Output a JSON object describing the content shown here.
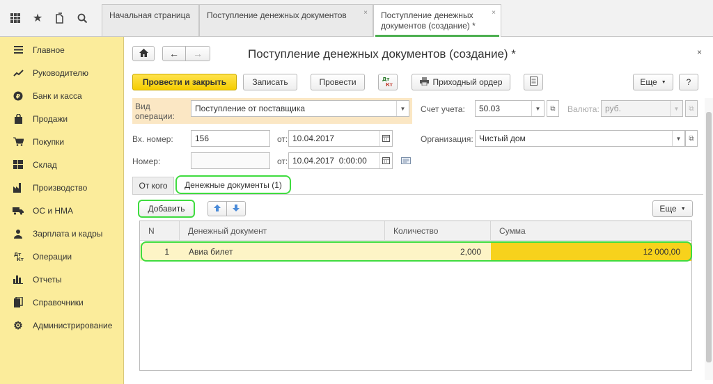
{
  "tabs": [
    {
      "label": "Начальная страница"
    },
    {
      "label": "Поступление денежных документов",
      "close": "×"
    },
    {
      "label": "Поступление денежных документов (создание) *",
      "close": "×"
    }
  ],
  "sidebar": {
    "items": [
      {
        "label": "Главное",
        "icon": "menu-icon"
      },
      {
        "label": "Руководителю",
        "icon": "trend-icon"
      },
      {
        "label": "Банк и касса",
        "icon": "ruble-icon"
      },
      {
        "label": "Продажи",
        "icon": "bag-icon"
      },
      {
        "label": "Покупки",
        "icon": "cart-icon"
      },
      {
        "label": "Склад",
        "icon": "grid-icon"
      },
      {
        "label": "Производство",
        "icon": "factory-icon"
      },
      {
        "label": "ОС и НМА",
        "icon": "truck-icon"
      },
      {
        "label": "Зарплата и кадры",
        "icon": "people-icon"
      },
      {
        "label": "Операции",
        "icon": "dt-kt-icon"
      },
      {
        "label": "Отчеты",
        "icon": "bar-chart-icon"
      },
      {
        "label": "Справочники",
        "icon": "book-icon"
      },
      {
        "label": "Администрирование",
        "icon": "gear-icon"
      }
    ]
  },
  "form": {
    "title": "Поступление денежных документов (создание) *",
    "close": "×",
    "toolbar": {
      "post_close": "Провести и закрыть",
      "save": "Записать",
      "post": "Провести",
      "dtkt": "Дт\nКт",
      "print": "Приходный ордер",
      "more": "Еще",
      "help": "?"
    },
    "operation_label": "Вид операции:",
    "operation_value": "Поступление от поставщика",
    "account_label": "Счет учета:",
    "account_value": "50.03",
    "currency_label": "Валюта:",
    "currency_value": "руб.",
    "in_number_label": "Вх. номер:",
    "in_number_value": "156",
    "from_label": "от:",
    "in_date": "10.04.2017",
    "org_label": "Организация:",
    "org_value": "Чистый дом",
    "number_label": "Номер:",
    "number_value": "",
    "doc_date": "10.04.2017  0:00:00"
  },
  "inner_tabs": {
    "from_whom": "От кого",
    "money_docs": "Денежные документы (1)"
  },
  "table_toolbar": {
    "add": "Добавить",
    "more": "Еще"
  },
  "table": {
    "columns": [
      "N",
      "Денежный документ",
      "Количество",
      "Сумма"
    ],
    "rows": [
      {
        "n": "1",
        "doc": "Авиа билет",
        "qty": "2,000",
        "sum": "12 000,00"
      }
    ]
  },
  "colors": {
    "sidebar_bg": "#fbec9b",
    "primary_button": "#f5cd00",
    "highlight_outline": "#3fdc3f",
    "selected_cell": "#f7d21c"
  }
}
